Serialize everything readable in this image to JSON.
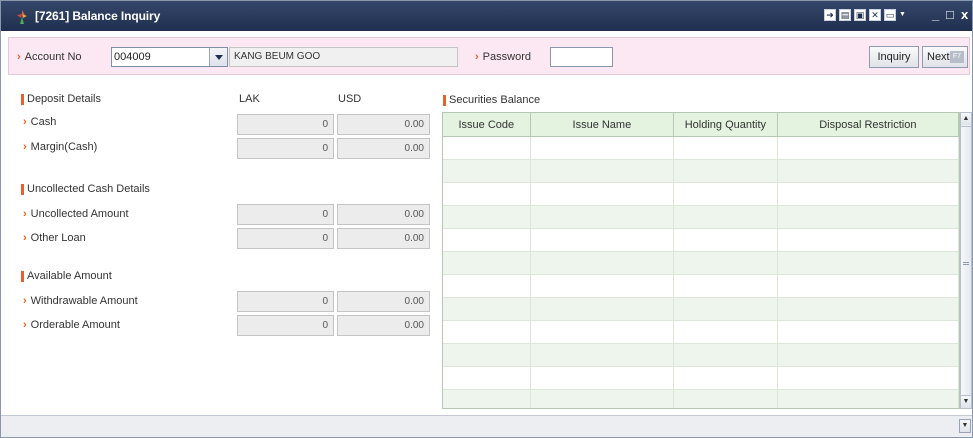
{
  "window": {
    "title": "[7261] Balance Inquiry",
    "toolbar_icons": [
      "pin-icon",
      "sheet-icon",
      "print-preview-icon",
      "excel-icon",
      "print-icon"
    ],
    "minimize_glyph": "_",
    "maximize_glyph": "□",
    "close_glyph": "x"
  },
  "account_bar": {
    "account_label": "Account No",
    "account_value": "004009",
    "account_name": "KANG BEUM GOO",
    "password_label": "Password",
    "inquiry_label": "Inquiry",
    "next_label": "Next",
    "next_key": "F7"
  },
  "deposit": {
    "section_title": "Deposit Details",
    "col_lak": "LAK",
    "col_usd": "USD",
    "rows": [
      {
        "label": "Cash",
        "lak": "0",
        "usd": "0.00"
      },
      {
        "label": "Margin(Cash)",
        "lak": "0",
        "usd": "0.00"
      }
    ]
  },
  "uncollected": {
    "section_title": "Uncollected Cash Details",
    "rows": [
      {
        "label": "Uncollected Amount",
        "lak": "0",
        "usd": "0.00"
      },
      {
        "label": "Other Loan",
        "lak": "0",
        "usd": "0.00"
      }
    ]
  },
  "available": {
    "section_title": "Available Amount",
    "rows": [
      {
        "label": "Withdrawable Amount",
        "lak": "0",
        "usd": "0.00"
      },
      {
        "label": "Orderable Amount",
        "lak": "0",
        "usd": "0.00"
      }
    ]
  },
  "securities": {
    "section_title": "Securities Balance",
    "columns": [
      "Issue Code",
      "Issue Name",
      "Holding Quantity",
      "Disposal Restriction"
    ],
    "rows": []
  },
  "colors": {
    "titlebar": "#1f2f4f",
    "accent": "#e8602b",
    "account_bar_bg": "#fbe8f2",
    "grid_header_bg": "#e4f2e0"
  }
}
